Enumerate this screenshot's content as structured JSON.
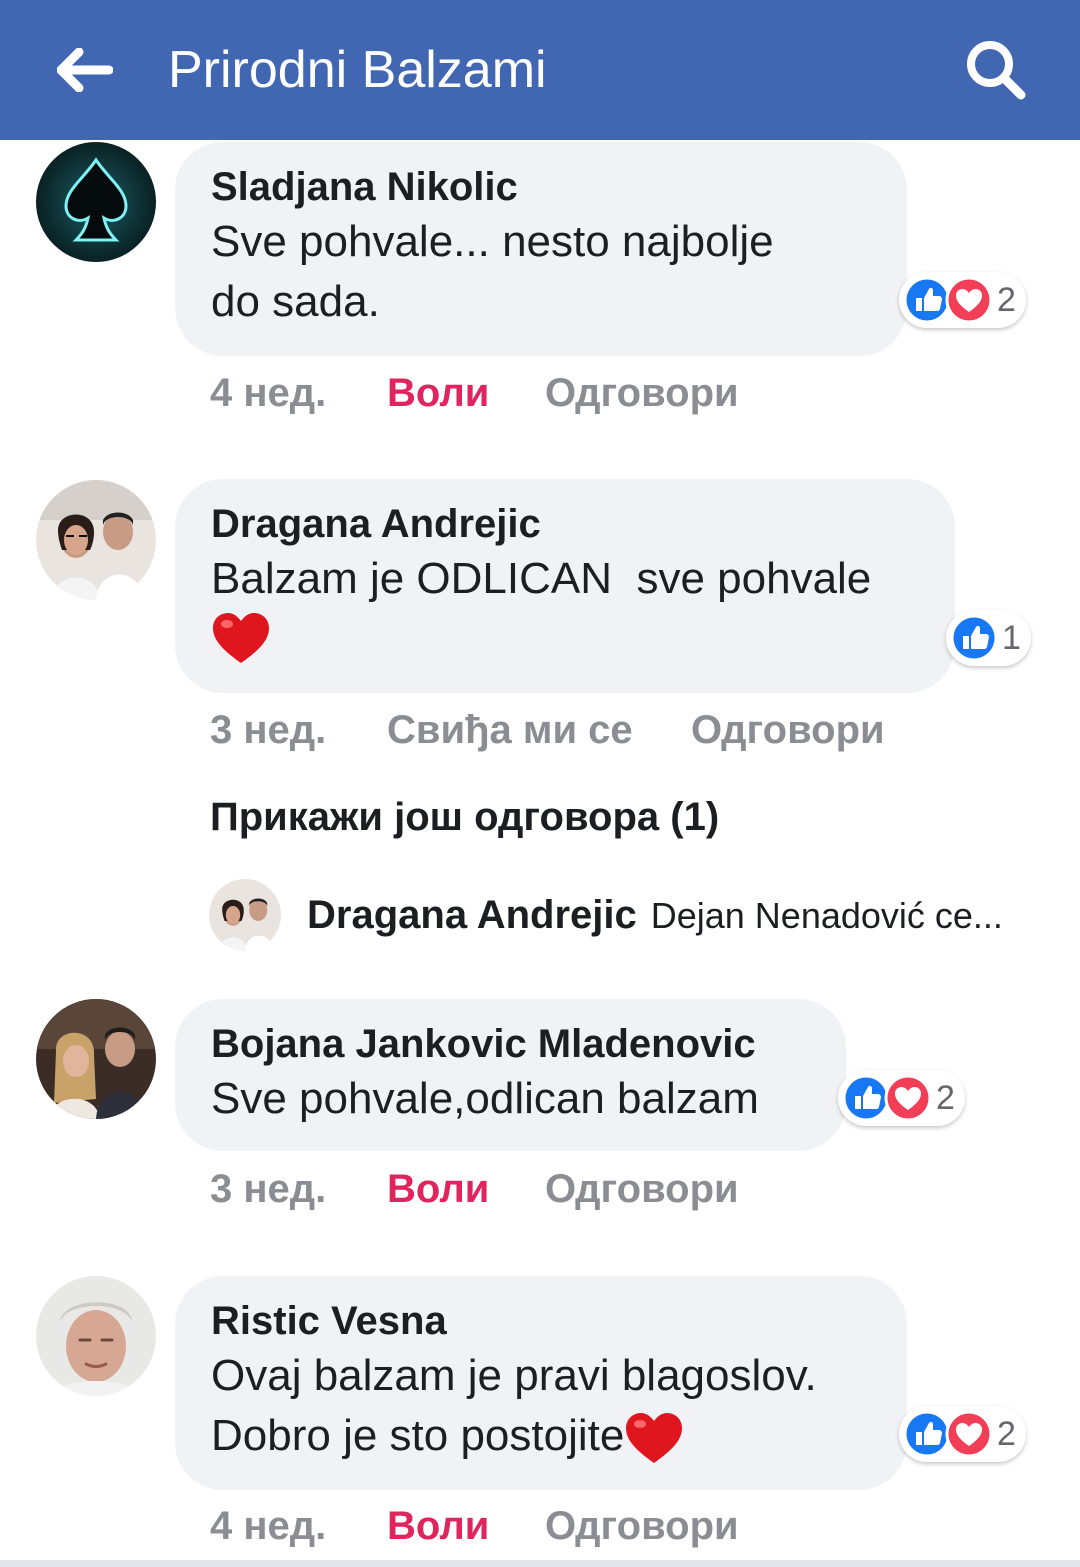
{
  "header": {
    "title": "Prirodni Balzami",
    "bg_color": "#4267b2",
    "back_icon": "arrow-left-icon",
    "search_icon": "search-icon"
  },
  "colors": {
    "bubble": "#f0f2f5",
    "liked": "#e0245e",
    "meta": "#8a8d91",
    "like_blue": "#1877f2",
    "love_red": "#f33e58"
  },
  "comments": [
    {
      "author": "Sladjana Nikolic",
      "text_lines": [
        "Sve pohvale... nesto najbolje",
        "do sada."
      ],
      "reactions": [
        "like",
        "love"
      ],
      "reaction_count": "2",
      "time": "4 нед.",
      "like_label": "Воли",
      "like_active": true,
      "reply_label": "Одговори"
    },
    {
      "author": "Dragana Andrejic",
      "text_lines": [
        "Balzam je ODLICAN  sve pohvale"
      ],
      "emoji": "heart",
      "reactions": [
        "like"
      ],
      "reaction_count": "1",
      "time": "3 нед.",
      "like_label": "Свиђа ми се",
      "like_active": false,
      "reply_label": "Одговори",
      "more_replies": "Прикажи још одговора (1)",
      "reply_preview": {
        "author": "Dragana Andrejic",
        "text": "Dejan Nenadović ce..."
      }
    },
    {
      "author": "Bojana Jankovic Mladenovic",
      "text_lines": [
        "Sve pohvale,odlican balzam"
      ],
      "reactions": [
        "like",
        "love"
      ],
      "reaction_count": "2",
      "time": "3 нед.",
      "like_label": "Воли",
      "like_active": true,
      "reply_label": "Одговори"
    },
    {
      "author": "Ristic Vesna",
      "text_lines": [
        "Ovaj balzam je pravi blagoslov.",
        "Dobro je sto postojite"
      ],
      "emoji": "heart",
      "reactions": [
        "like",
        "love"
      ],
      "reaction_count": "2",
      "time": "4 нед.",
      "like_label": "Воли",
      "like_active": true,
      "reply_label": "Одговори"
    }
  ]
}
